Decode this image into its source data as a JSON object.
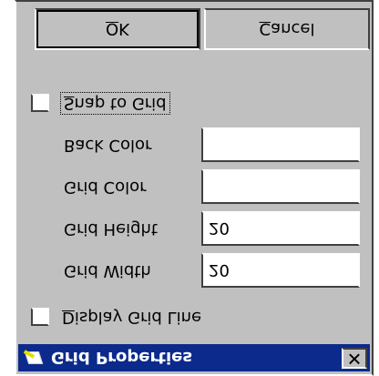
{
  "dialog": {
    "title": "Grid Properties",
    "close_glyph": "✕"
  },
  "display_grid_lines": {
    "label_access": "D",
    "label_rest": "isplay Grid Line",
    "checked": false
  },
  "grid_width": {
    "label": "Grid Width",
    "value": "20"
  },
  "grid_height": {
    "label": "Grid Height",
    "value": "20"
  },
  "grid_color": {
    "label": "Grid Color",
    "value": ""
  },
  "back_color": {
    "label": "Back Color",
    "value": ""
  },
  "snap_to_grid": {
    "label_access": "S",
    "label_rest": "nap to Grid",
    "checked": false
  },
  "buttons": {
    "ok_access": "O",
    "ok_rest": "K",
    "cancel_access": "C",
    "cancel_rest": "ancel"
  },
  "icons": {
    "title": "grid-properties-icon",
    "close": "close-icon"
  }
}
